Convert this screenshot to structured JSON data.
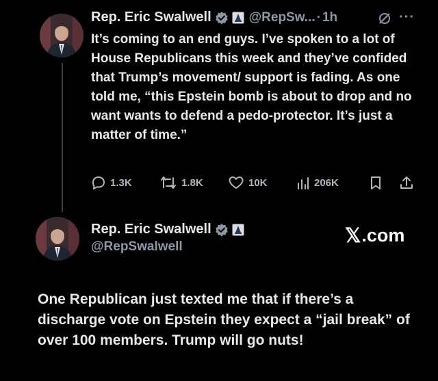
{
  "post1": {
    "name": "Rep. Eric Swalwell",
    "handle": "@RepSw...",
    "separator": "·",
    "time": "1h",
    "more": "···",
    "text": "It’s coming to an end guys. I’ve spoken to a lot of House Republicans this week and they’ve confided that Trump’s movement/ support is fading. As one told me, “this Epstein bomb is about to drop and no want wants to defend a pedo-protector. It’s just a matter of time.”",
    "stats": {
      "replies": "1.3K",
      "reposts": "1.8K",
      "likes": "10K",
      "views": "206K"
    },
    "icons": [
      "verified-badge-icon",
      "government-badge-icon",
      "grok-icon",
      "more-icon",
      "reply-icon",
      "repost-icon",
      "like-icon",
      "views-icon",
      "bookmark-icon",
      "share-icon"
    ]
  },
  "post2": {
    "name": "Rep. Eric Swalwell",
    "handle": "@RepSwalwell",
    "watermark_x": "𝕏",
    "watermark_text": ".com",
    "text": "One Republican just texted me that if there’s a discharge vote on Epstein they expect a “jail break” of over 100 members.  Trump will go nuts!"
  },
  "colors": {
    "background": "#000000",
    "text": "#e7e9ea",
    "secondary": "#8b98a5",
    "verified": "#8a96a3"
  }
}
